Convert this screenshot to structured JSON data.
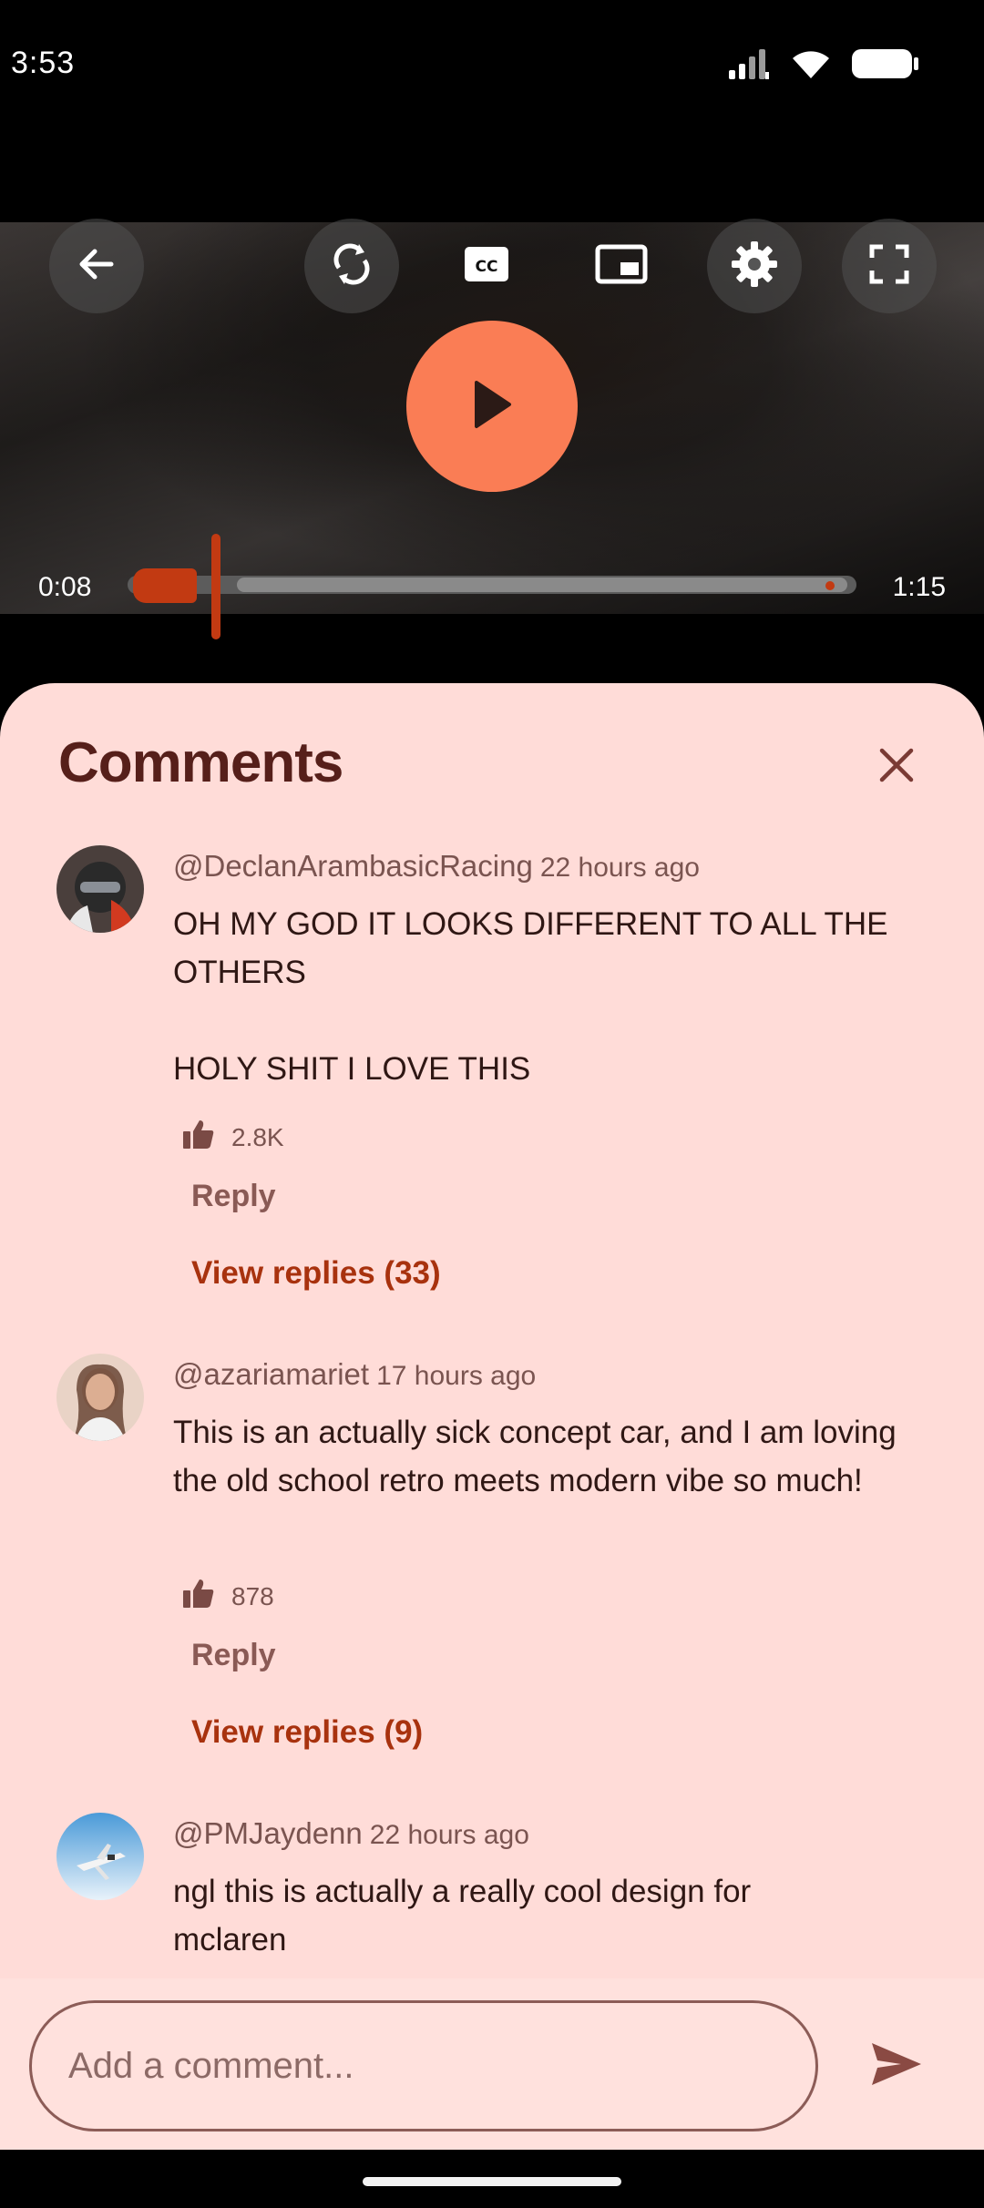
{
  "status_bar": {
    "time": "3:53",
    "icons": [
      "signal-icon",
      "wifi-icon",
      "battery-icon"
    ]
  },
  "player": {
    "controls": [
      "back-arrow-icon",
      "autoplay-icon",
      "closed-captions-icon",
      "picture-in-picture-icon",
      "settings-gear-icon",
      "fullscreen-icon"
    ],
    "play_icon": "play-icon",
    "current_time": "0:08",
    "total_time": "1:15",
    "progress_fraction": 0.107,
    "accent_color": "#c23a12",
    "play_button_color": "#fa7d55"
  },
  "comments_sheet": {
    "title": "Comments",
    "close_icon": "close-icon",
    "comments": [
      {
        "user": "@DeclanArambasicRacing",
        "time_ago": "22 hours ago",
        "text": "OH MY GOD IT LOOKS DIFFERENT TO ALL THE OTHERS\n\nHOLY SHIT I LOVE THIS",
        "likes": "2.8K",
        "reply_label": "Reply",
        "view_replies_label": "View replies (33)"
      },
      {
        "user": "@azariamariet",
        "time_ago": "17 hours ago",
        "text": "This is an actually sick concept car, and I am loving the old school retro meets modern vibe so much!",
        "likes": "878",
        "reply_label": "Reply",
        "view_replies_label": "View replies (9)"
      },
      {
        "user": "@PMJaydenn",
        "time_ago": "22 hours ago",
        "text": "ngl this is actually a really cool design for mclaren"
      }
    ],
    "composer": {
      "placeholder": "Add a comment...",
      "send_icon": "send-icon"
    },
    "colors": {
      "sheet_background": "#ffdcd8",
      "title": "#561f1a",
      "link": "#a8320e"
    }
  }
}
